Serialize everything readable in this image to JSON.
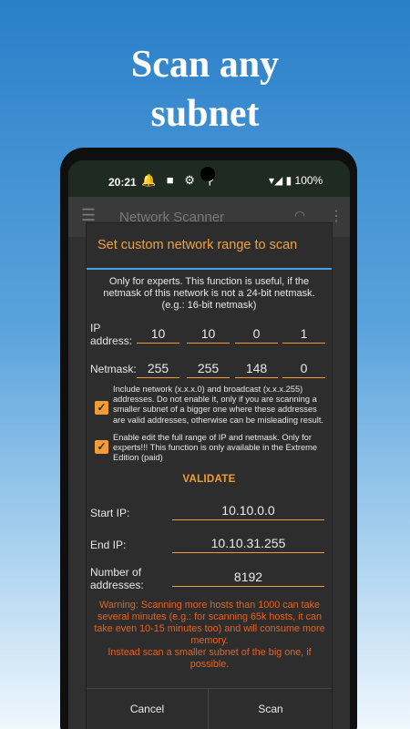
{
  "hero": {
    "line1": "Scan any",
    "line2": "subnet"
  },
  "statusbar": {
    "time": "20:21",
    "icons_left": "🔔 ■ ⚙ ⚲",
    "battery": "▾◢ ▮ 100%",
    "icon_names": [
      "notification-bell-icon",
      "square-icon",
      "settings-icon",
      "location-icon",
      "wifi-icon",
      "signal-icon",
      "battery-icon"
    ]
  },
  "appbar": {
    "title": "Network Scanner",
    "menu_glyph": "☰",
    "wifi_glyph": "◠",
    "more_glyph": "⋮"
  },
  "dialog": {
    "title": "Set custom network range to scan",
    "intro": "Only for experts. This function is useful, if the netmask of this network is not a 24-bit netmask. (e.g.: 16-bit netmask)",
    "ip_label_1": "IP",
    "ip_label_2": "address:",
    "ip_octets": [
      "10",
      "10",
      "0",
      "1"
    ],
    "netmask_label": "Netmask:",
    "netmask_octets": [
      "255",
      "255",
      "148",
      "0"
    ],
    "check1": {
      "checked": true,
      "text": "Include network (x.x.x.0) and broadcast (x.x.x.255) addresses. Do not enable it, only if you are scanning a smaller subnet of a bigger one where these addresses are valid addresses, otherwise can be misleading result."
    },
    "check2": {
      "checked": true,
      "text": "Enable edit the full range of IP and netmask. Only for experts!!! This function is only available in the Extreme Edition (paid)"
    },
    "validate_label": "VALIDATE",
    "start_ip_label": "Start IP:",
    "start_ip": "10.10.0.0",
    "end_ip_label": "End IP:",
    "end_ip": "10.10.31.255",
    "num_label_1": "Number of",
    "num_label_2": "addresses:",
    "num_addresses": "8192",
    "warning": "Warning: Scanning more hosts than 1000 can take several minutes (e.g.: for scanning 65k hosts, it can take even 10-15 minutes too) and will consume more memory.",
    "warning2": "Instead scan a smaller subnet of the big one, if possible.",
    "cancel_label": "Cancel",
    "scan_label": "Scan"
  },
  "colors": {
    "accent": "#f39c33",
    "divider": "#3ea8e6",
    "warning": "#e8621e"
  }
}
